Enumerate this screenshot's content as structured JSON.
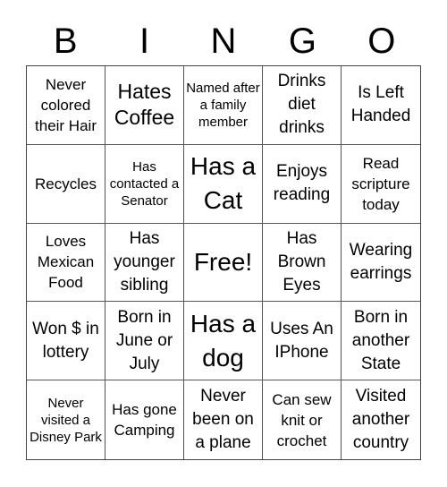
{
  "header": {
    "letters": [
      "B",
      "I",
      "N",
      "G",
      "O"
    ]
  },
  "cells": [
    {
      "text": "Never colored their Hair",
      "size": "s-sm"
    },
    {
      "text": "Hates Coffee",
      "size": "s-lg"
    },
    {
      "text": "Named after a family member",
      "size": "s-xs"
    },
    {
      "text": "Drinks diet drinks",
      "size": "s-md"
    },
    {
      "text": "Is Left Handed",
      "size": "s-md"
    },
    {
      "text": "Recycles",
      "size": "s-sm"
    },
    {
      "text": "Has contacted a Senator",
      "size": "s-xs"
    },
    {
      "text": "Has a Cat",
      "size": "s-xl"
    },
    {
      "text": "Enjoys reading",
      "size": "s-md"
    },
    {
      "text": "Read scripture today",
      "size": "s-sm"
    },
    {
      "text": "Loves Mexican Food",
      "size": "s-sm"
    },
    {
      "text": "Has younger sibling",
      "size": "s-md"
    },
    {
      "text": "Free!",
      "size": "s-xl"
    },
    {
      "text": "Has Brown Eyes",
      "size": "s-md"
    },
    {
      "text": "Wearing earrings",
      "size": "s-md"
    },
    {
      "text": "Won $ in lottery",
      "size": "s-md"
    },
    {
      "text": "Born in June or July",
      "size": "s-md"
    },
    {
      "text": "Has a dog",
      "size": "s-xl"
    },
    {
      "text": "Uses An IPhone",
      "size": "s-md"
    },
    {
      "text": "Born in another State",
      "size": "s-md"
    },
    {
      "text": "Never visited a Disney Park",
      "size": "s-xs"
    },
    {
      "text": "Has gone Camping",
      "size": "s-sm"
    },
    {
      "text": "Never been on a plane",
      "size": "s-md"
    },
    {
      "text": "Can sew knit or crochet",
      "size": "s-sm"
    },
    {
      "text": "Visited another country",
      "size": "s-md"
    }
  ]
}
